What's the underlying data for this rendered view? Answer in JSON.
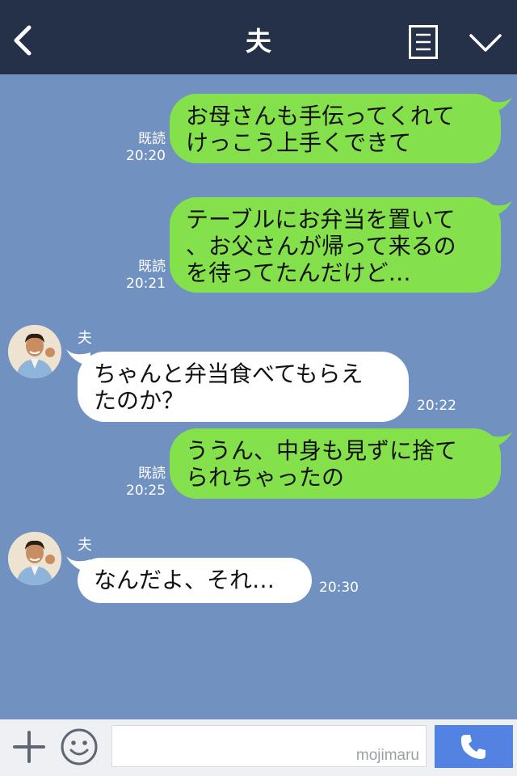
{
  "header": {
    "title": "夫",
    "icons": {
      "back": "chevron-left-icon",
      "menu": "notes-list-icon",
      "dropdown": "chevron-down-icon"
    }
  },
  "messages": [
    {
      "direction": "out",
      "text": "お母さんも手伝ってくれて\nけっこう上手くできて",
      "read": "既読",
      "time": "20:20"
    },
    {
      "direction": "out",
      "text": "テーブルにお弁当を置いて\n、お父さんが帰って来るの\nを待ってたんだけど…",
      "read": "既読",
      "time": "20:21"
    },
    {
      "direction": "in",
      "sender": "夫",
      "text": "ちゃんと弁当食べてもらえ\nたのか？",
      "time": "20:22"
    },
    {
      "direction": "out",
      "text": "ううん、中身も見ずに捨て\nられちゃったの",
      "read": "既読",
      "time": "20:25"
    },
    {
      "direction": "in",
      "sender": "夫",
      "text": "なんだよ、それ…",
      "time": "20:30"
    }
  ],
  "input": {
    "placeholder": "",
    "watermark": "mojimaru"
  },
  "footer": {
    "icons": {
      "add": "plus-icon",
      "sticker": "smiley-icon",
      "call": "phone-icon"
    }
  },
  "colors": {
    "header_bg": "#253148",
    "chat_bg": "#7191c1",
    "outgoing_bubble": "#84e14b",
    "incoming_bubble": "#ffffff",
    "call_button": "#5283e3"
  }
}
